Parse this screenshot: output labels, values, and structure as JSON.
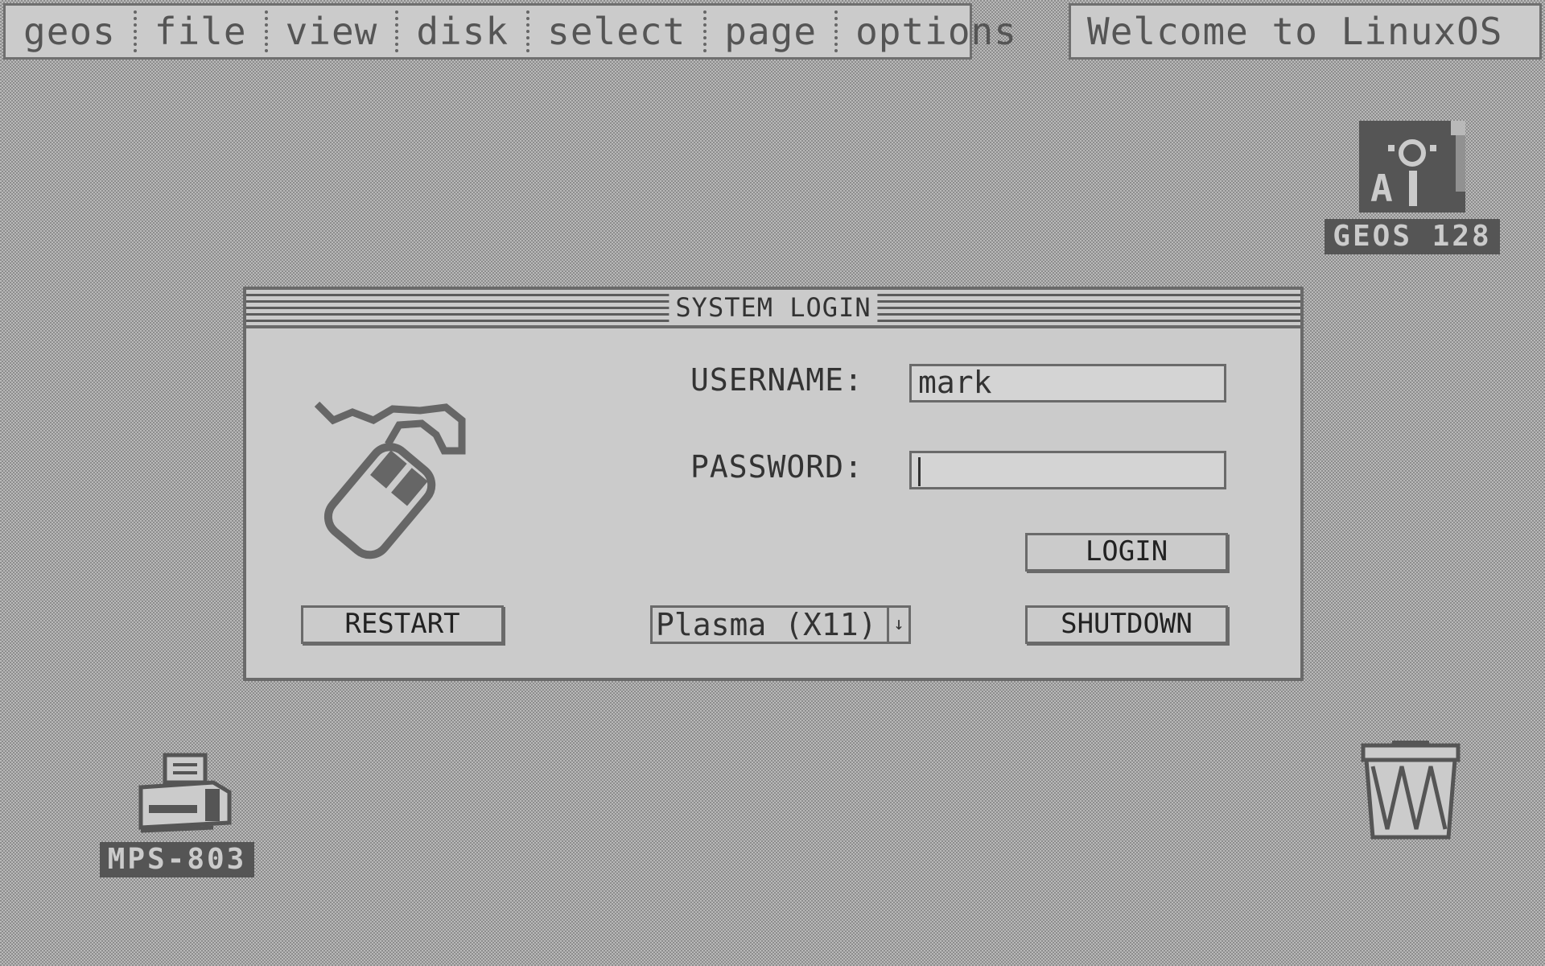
{
  "menu": [
    "geos",
    "file",
    "view",
    "disk",
    "select",
    "page",
    "options"
  ],
  "welcome": "Welcome to LinuxOS",
  "desktop": {
    "geos_label": "GEOS 128",
    "printer_label": "MPS-803"
  },
  "dialog": {
    "title": "SYSTEM LOGIN",
    "username_label": "USERNAME:",
    "username_value": "mark",
    "password_label": "PASSWORD:",
    "password_value": "",
    "login_label": "LOGIN",
    "restart_label": "RESTART",
    "shutdown_label": "SHUTDOWN",
    "session": "Plasma (X11)"
  },
  "icons": {
    "geos": "geos-app-icon",
    "printer": "printer-icon",
    "trash": "trash-icon",
    "mouse": "mouse-icon",
    "dropdown": "arrow-down-icon"
  }
}
